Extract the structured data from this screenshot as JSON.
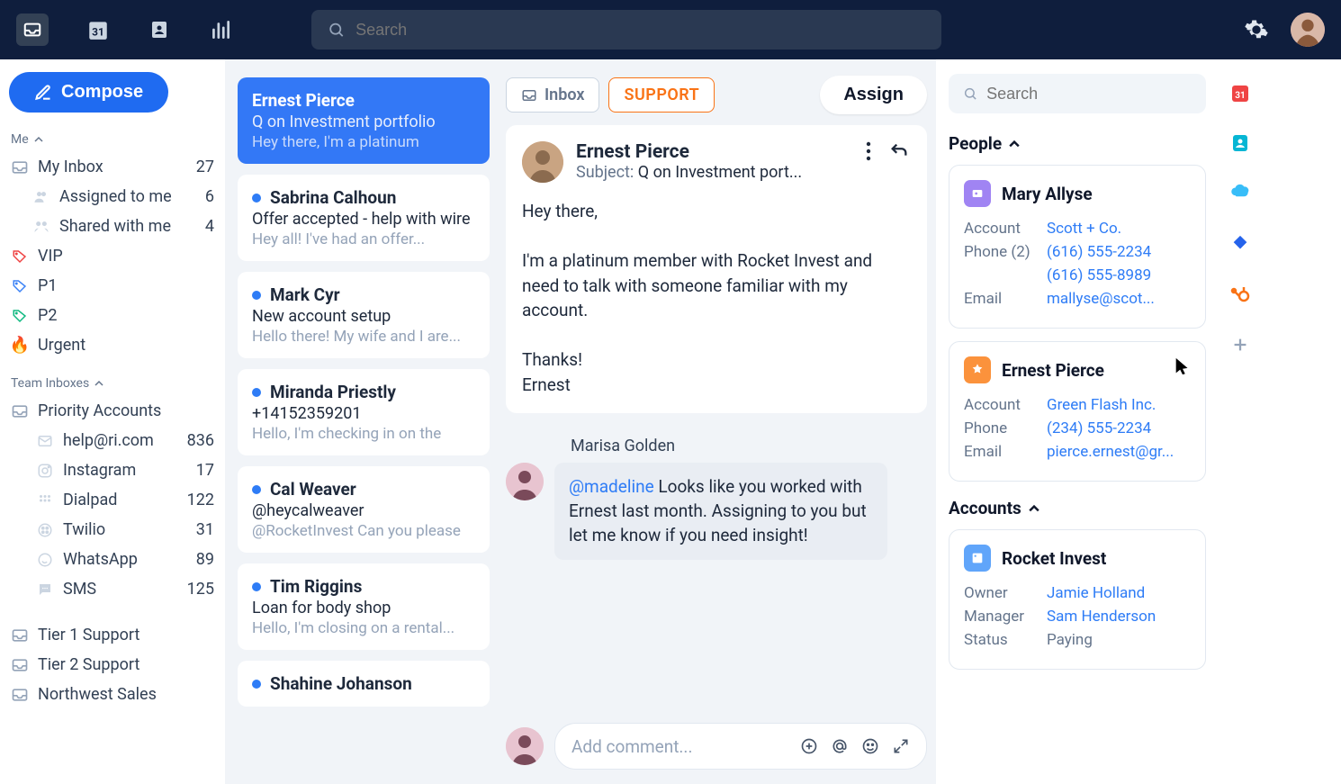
{
  "top": {
    "search_placeholder": "Search"
  },
  "compose_label": "Compose",
  "sections": {
    "me_label": "Me",
    "me_items": [
      {
        "label": "My Inbox",
        "count": "27"
      },
      {
        "label": "Assigned to me",
        "count": "6"
      },
      {
        "label": "Shared with me",
        "count": "4"
      }
    ],
    "tags": [
      {
        "label": "VIP",
        "color": "red"
      },
      {
        "label": "P1",
        "color": "blue"
      },
      {
        "label": "P2",
        "color": "green"
      },
      {
        "label": "Urgent",
        "color": "fire"
      }
    ],
    "team_label": "Team Inboxes",
    "team_items": [
      {
        "label": "Priority Accounts",
        "count": ""
      },
      {
        "label": "help@ri.com",
        "count": "836"
      },
      {
        "label": "Instagram",
        "count": "17"
      },
      {
        "label": "Dialpad",
        "count": "122"
      },
      {
        "label": "Twilio",
        "count": "31"
      },
      {
        "label": "WhatsApp",
        "count": "89"
      },
      {
        "label": "SMS",
        "count": "125"
      }
    ],
    "tiers": [
      {
        "label": "Tier 1 Support"
      },
      {
        "label": "Tier 2 Support"
      },
      {
        "label": "Northwest Sales"
      }
    ]
  },
  "conversations": [
    {
      "name": "Ernest Pierce",
      "subject": "Q on Investment portfolio",
      "preview": "Hey there, I'm a platinum",
      "selected": true,
      "dot": false
    },
    {
      "name": "Sabrina Calhoun",
      "subject": "Offer accepted - help with wire",
      "preview": "Hey all! I've had an offer...",
      "dot": true
    },
    {
      "name": "Mark Cyr",
      "subject": "New account setup",
      "preview": "Hello there! My wife and I are...",
      "dot": true
    },
    {
      "name": "Miranda Priestly",
      "subject": "+14152359201",
      "preview": "Hello, I'm checking in on the",
      "dot": true
    },
    {
      "name": "Cal Weaver",
      "subject": "@heycalweaver",
      "preview": "@RocketInvest Can you please",
      "dot": true
    },
    {
      "name": "Tim Riggins",
      "subject": "Loan for body shop",
      "preview": "Hello, I'm closing on a rental...",
      "dot": true
    },
    {
      "name": "Shahine Johanson",
      "subject": "",
      "preview": "",
      "dot": true
    }
  ],
  "detail": {
    "inbox_label": "Inbox",
    "support_label": "SUPPORT",
    "assign_label": "Assign",
    "sender": "Ernest Pierce",
    "subject_label": "Subject:",
    "subject": "Q on Investment port...",
    "body": "Hey there,\n\nI'm a platinum member with Rocket Invest and need to talk with someone familiar with my account.\n\nThanks!\nErnest",
    "note_author": "Marisa Golden",
    "comment_mention": "@madeline",
    "comment_text": " Looks like you worked with Ernest last month. Assigning to you but let me know if you need insight!",
    "comment_placeholder": "Add comment..."
  },
  "rpanel": {
    "search_placeholder": "Search",
    "people_label": "People",
    "people": [
      {
        "name": "Mary Allyse",
        "badge": "purple",
        "fields": [
          {
            "k": "Account",
            "v": "Scott + Co."
          },
          {
            "k": "Phone (2)",
            "v": "(616) 555-2234"
          },
          {
            "k": "",
            "v": "(616) 555-8989"
          },
          {
            "k": "Email",
            "v": "mallyse@scot..."
          }
        ]
      },
      {
        "name": "Ernest Pierce",
        "badge": "orange",
        "cursor": true,
        "fields": [
          {
            "k": "Account",
            "v": "Green Flash Inc."
          },
          {
            "k": "Phone",
            "v": "(234) 555-2234"
          },
          {
            "k": "Email",
            "v": "pierce.ernest@gr..."
          }
        ]
      }
    ],
    "accounts_label": "Accounts",
    "accounts": [
      {
        "name": "Rocket Invest",
        "badge": "blue",
        "fields": [
          {
            "k": "Owner",
            "v": "Jamie Holland"
          },
          {
            "k": "Manager",
            "v": "Sam Henderson"
          },
          {
            "k": "Status",
            "v": "Paying",
            "gray": true
          }
        ]
      }
    ]
  }
}
